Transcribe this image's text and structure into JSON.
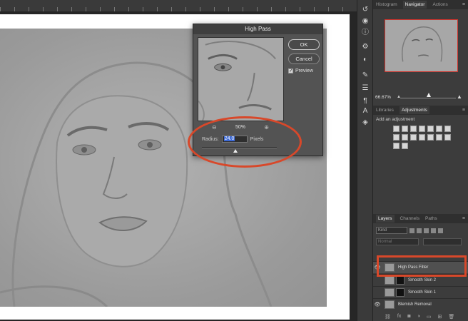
{
  "dialog": {
    "title": "High Pass",
    "ok_label": "OK",
    "cancel_label": "Cancel",
    "preview_label": "Preview",
    "preview_checked": true,
    "zoom": "50%",
    "radius_label": "Radius:",
    "radius_value": "24.0",
    "radius_unit": "Pixels"
  },
  "panels": {
    "top_tabs": [
      "Histogram",
      "Navigator",
      "Actions"
    ],
    "navigator_zoom": "66.67%",
    "mid_tabs": [
      "Libraries",
      "Adjustments"
    ],
    "adjustments_hint": "Add an adjustment",
    "layer_tabs": [
      "Layers",
      "Channels",
      "Paths"
    ],
    "kind_label": "Kind",
    "blend_mode": "Normal",
    "layers": [
      {
        "name": "High Pass Filter",
        "visible": true,
        "selected": true,
        "has_mask": false
      },
      {
        "name": "Smooth Skin 2",
        "visible": false,
        "selected": false,
        "has_mask": true
      },
      {
        "name": "Smooth Skin 1",
        "visible": false,
        "selected": false,
        "has_mask": true
      },
      {
        "name": "Blemish Removal",
        "visible": true,
        "selected": false,
        "has_mask": false
      }
    ],
    "footer_icons": [
      "link-icon",
      "fx-icon",
      "mask-icon",
      "adjustment-icon",
      "folder-icon",
      "new-layer-icon",
      "trash-icon"
    ]
  },
  "colors": {
    "highlight": "#d8482a",
    "selection_field": "#3d6ad6",
    "panel_bg": "#3c3c3c"
  }
}
